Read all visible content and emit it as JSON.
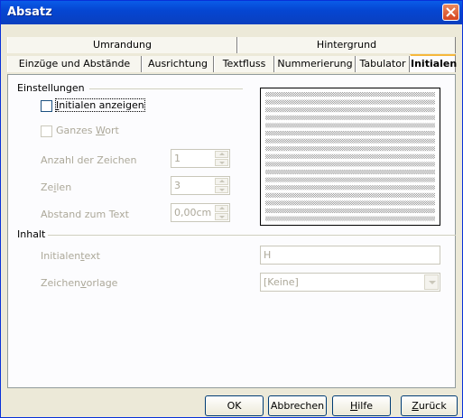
{
  "window": {
    "title": "Absatz"
  },
  "tabs": {
    "row1": [
      "Umrandung",
      "Hintergrund"
    ],
    "row2": [
      "Einzüge und Abstände",
      "Ausrichtung",
      "Textfluss",
      "Nummerierung",
      "Tabulator",
      "Initialen"
    ],
    "active": "Initialen"
  },
  "einstellungen": {
    "heading": "Einstellungen",
    "show_drop_caps": {
      "pre": "",
      "u": "I",
      "post": "nitialen anzeigen",
      "checked": false
    },
    "whole_word": {
      "pre": "Ganzes ",
      "u": "W",
      "post": "ort",
      "checked": false
    },
    "num_chars": {
      "label": "Anzahl der Zeichen",
      "value": "1"
    },
    "lines": {
      "pre": "Ze",
      "u": "i",
      "post": "len",
      "value": "3"
    },
    "distance": {
      "label": "Abstand zum Text",
      "value": "0,00cm"
    }
  },
  "inhalt": {
    "heading": "Inhalt",
    "text": {
      "pre": "Initialen",
      "u": "t",
      "post": "ext",
      "value": "H"
    },
    "charstyle": {
      "pre": "Zeichen",
      "u": "v",
      "post": "orlage",
      "value": "[Keine]"
    }
  },
  "buttons": {
    "ok": "OK",
    "cancel": "Abbrechen",
    "help": {
      "u": "H",
      "post": "ilfe"
    },
    "back": {
      "u": "Z",
      "post": "urück"
    }
  },
  "colors": {
    "titlebar": "#0546d2",
    "active_tab_highlight": "#f6b83c",
    "dialog_bg": "#ece9d8"
  }
}
